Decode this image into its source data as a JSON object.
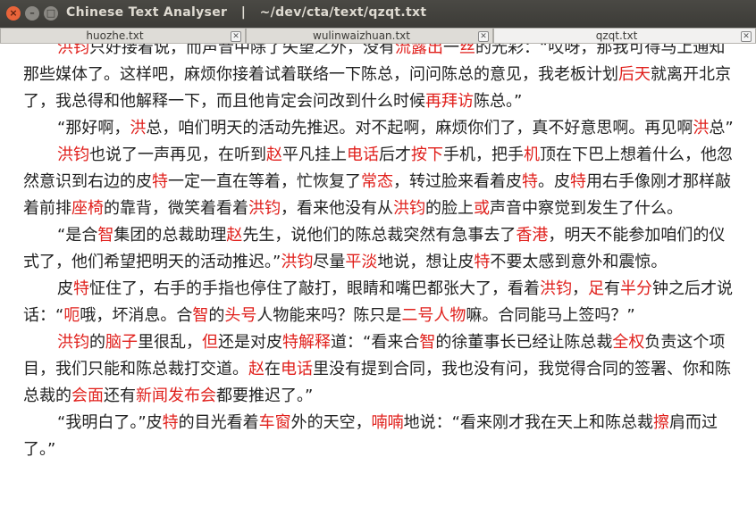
{
  "window": {
    "title": "Chinese Text Analyser   |   ~/dev/cta/text/qzqt.txt",
    "close_glyph": "×",
    "min_glyph": "–",
    "max_glyph": "□"
  },
  "tabs": [
    {
      "label": "huozhe.txt",
      "active": false
    },
    {
      "label": "wulinwaizhuan.txt",
      "active": false
    },
    {
      "label": "qzqt.txt",
      "active": true
    }
  ],
  "colors": {
    "highlight": "#e0201c",
    "text": "#222222"
  },
  "paragraphs": [
    [
      [
        "洪钧",
        true
      ],
      [
        "只好接着说，而声音中除了失望之外，没有",
        false
      ],
      [
        "流露出",
        true
      ],
      [
        "一",
        false
      ],
      [
        "丝",
        true
      ],
      [
        "的光彩：“哎呀，那我可得马上通知那些媒体了。这样吧，麻烦你接着试着联络一下陈总，问问陈总的意见，我老板计划",
        false
      ],
      [
        "后天",
        true
      ],
      [
        "就离开北京了，我总得和他解释一下，而且他肯定会问改到什么时候",
        false
      ],
      [
        "再拜访",
        true
      ],
      [
        "陈总。”",
        false
      ]
    ],
    [
      [
        "“那好啊，",
        false
      ],
      [
        "洪",
        true
      ],
      [
        "总，咱们明天的活动先推迟。对不起啊，麻烦你们了，真不好意思啊。再见啊",
        false
      ],
      [
        "洪",
        true
      ],
      [
        "总”",
        false
      ]
    ],
    [
      [
        "洪钧",
        true
      ],
      [
        "也说了一声再见，在听到",
        false
      ],
      [
        "赵",
        true
      ],
      [
        "平凡挂上",
        false
      ],
      [
        "电话",
        true
      ],
      [
        "后才",
        false
      ],
      [
        "按下",
        true
      ],
      [
        "手机，把手",
        false
      ],
      [
        "机",
        true
      ],
      [
        "顶在下巴上想着什么，他忽然意识到右边的皮",
        false
      ],
      [
        "特",
        true
      ],
      [
        "一定一直在等着，忙恢复了",
        false
      ],
      [
        "常态",
        true
      ],
      [
        "，转过脸来看着皮",
        false
      ],
      [
        "特",
        true
      ],
      [
        "。皮",
        false
      ],
      [
        "特",
        true
      ],
      [
        "用右手像刚才那样敲着前排",
        false
      ],
      [
        "座椅",
        true
      ],
      [
        "的靠背，微笑着看着",
        false
      ],
      [
        "洪钧",
        true
      ],
      [
        "，看来他没有从",
        false
      ],
      [
        "洪钧",
        true
      ],
      [
        "的脸上",
        false
      ],
      [
        "或",
        true
      ],
      [
        "声音中察觉到发生了什么。",
        false
      ]
    ],
    [
      [
        "“是合",
        false
      ],
      [
        "智",
        true
      ],
      [
        "集团的总裁助理",
        false
      ],
      [
        "赵",
        true
      ],
      [
        "先生，说他们的陈总裁突然有急事去了",
        false
      ],
      [
        "香港",
        true
      ],
      [
        "，明天不能参加咱们的仪式了，他们希望把明天的活动推迟。”",
        false
      ],
      [
        "洪钧",
        true
      ],
      [
        "尽量",
        false
      ],
      [
        "平淡",
        true
      ],
      [
        "地说，想让皮",
        false
      ],
      [
        "特",
        true
      ],
      [
        "不要太感到意外和震惊。",
        false
      ]
    ],
    [
      [
        "皮",
        false
      ],
      [
        "特",
        true
      ],
      [
        "怔住了，右手的手指也停住了敲打，眼睛和嘴巴都张大了，看着",
        false
      ],
      [
        "洪钧",
        true
      ],
      [
        "，",
        false
      ],
      [
        "足",
        true
      ],
      [
        "有",
        false
      ],
      [
        "半分",
        true
      ],
      [
        "钟之后才说话：“",
        false
      ],
      [
        "呃",
        true
      ],
      [
        "哦，坏消息。合",
        false
      ],
      [
        "智",
        true
      ],
      [
        "的",
        false
      ],
      [
        "头号",
        true
      ],
      [
        "人物能来吗？陈只是",
        false
      ],
      [
        "二号人物",
        true
      ],
      [
        "嘛。合同能马上签吗？”",
        false
      ]
    ],
    [
      [
        "洪钧",
        true
      ],
      [
        "的",
        false
      ],
      [
        "脑子",
        true
      ],
      [
        "里很乱，",
        false
      ],
      [
        "但",
        true
      ],
      [
        "还是对皮",
        false
      ],
      [
        "特解释",
        true
      ],
      [
        "道：“看来合",
        false
      ],
      [
        "智",
        true
      ],
      [
        "的徐董事长已经让陈总裁",
        false
      ],
      [
        "全权",
        true
      ],
      [
        "负责这个项目，我们只能和陈总裁打交道。",
        false
      ],
      [
        "赵",
        true
      ],
      [
        "在",
        false
      ],
      [
        "电话",
        true
      ],
      [
        "里没有提到合同，我也没有问，我觉得合同的签署、你和陈总裁的",
        false
      ],
      [
        "会面",
        true
      ],
      [
        "还有",
        false
      ],
      [
        "新闻发布会",
        true
      ],
      [
        "都要推迟了。”",
        false
      ]
    ],
    [
      [
        "“我明白了。”皮",
        false
      ],
      [
        "特",
        true
      ],
      [
        "的目光看着",
        false
      ],
      [
        "车窗",
        true
      ],
      [
        "外的天空，",
        false
      ],
      [
        "喃喃",
        true
      ],
      [
        "地说：“看来刚才我在天上和陈总裁",
        false
      ],
      [
        "擦",
        true
      ],
      [
        "肩而过了。”",
        false
      ]
    ]
  ]
}
